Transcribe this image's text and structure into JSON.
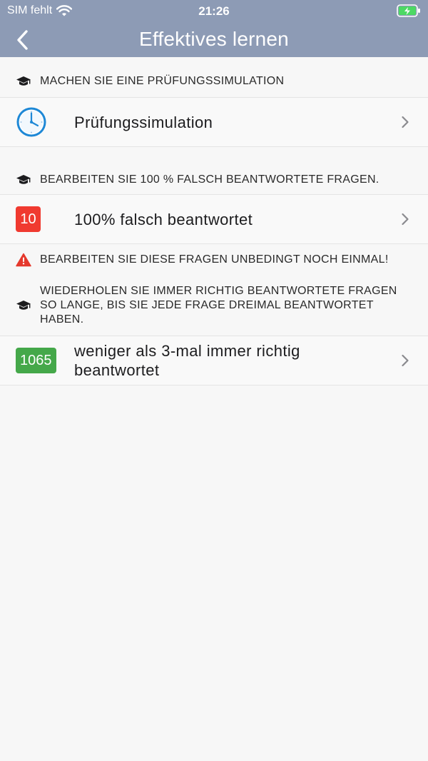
{
  "status_bar": {
    "carrier": "SIM fehlt",
    "time": "21:26"
  },
  "nav": {
    "title": "Effektives lernen"
  },
  "sections": {
    "simulation": {
      "header": "MACHEN SIE EINE PRÜFUNGSSIMULATION",
      "item_label": "Prüfungssimulation"
    },
    "wrong": {
      "header": "BEARBEITEN SIE 100 % FALSCH BEANTWORTETE FRAGEN.",
      "badge": "10",
      "item_label": "100% falsch beantwortet",
      "warning": "BEARBEITEN SIE DIESE FRAGEN UNBEDINGT NOCH EINMAL!"
    },
    "repeat": {
      "header_line1": "WIEDERHOLEN SIE IMMER RICHTIG BEANTWORTETE FRAGEN",
      "header_line2": "SO LANGE, BIS SIE JEDE FRAGE DREIMAL BEANTWORTET",
      "header_line3": "HABEN.",
      "badge": "1065",
      "item_label_line1": "weniger als 3-mal immer richtig",
      "item_label_line2": "beantwortet"
    }
  },
  "colors": {
    "header_bar": "#8d9bb5",
    "badge_wrong": "#f03a30",
    "badge_repeat": "#45a84a",
    "warning": "#e5392d"
  },
  "icons": {
    "back": "chevron-left-icon",
    "wifi": "wifi-icon",
    "battery": "battery-charging-icon",
    "section": "graduation-cap-icon",
    "clock": "clock-icon",
    "warning": "warning-icon",
    "chevron": "chevron-right-icon"
  }
}
